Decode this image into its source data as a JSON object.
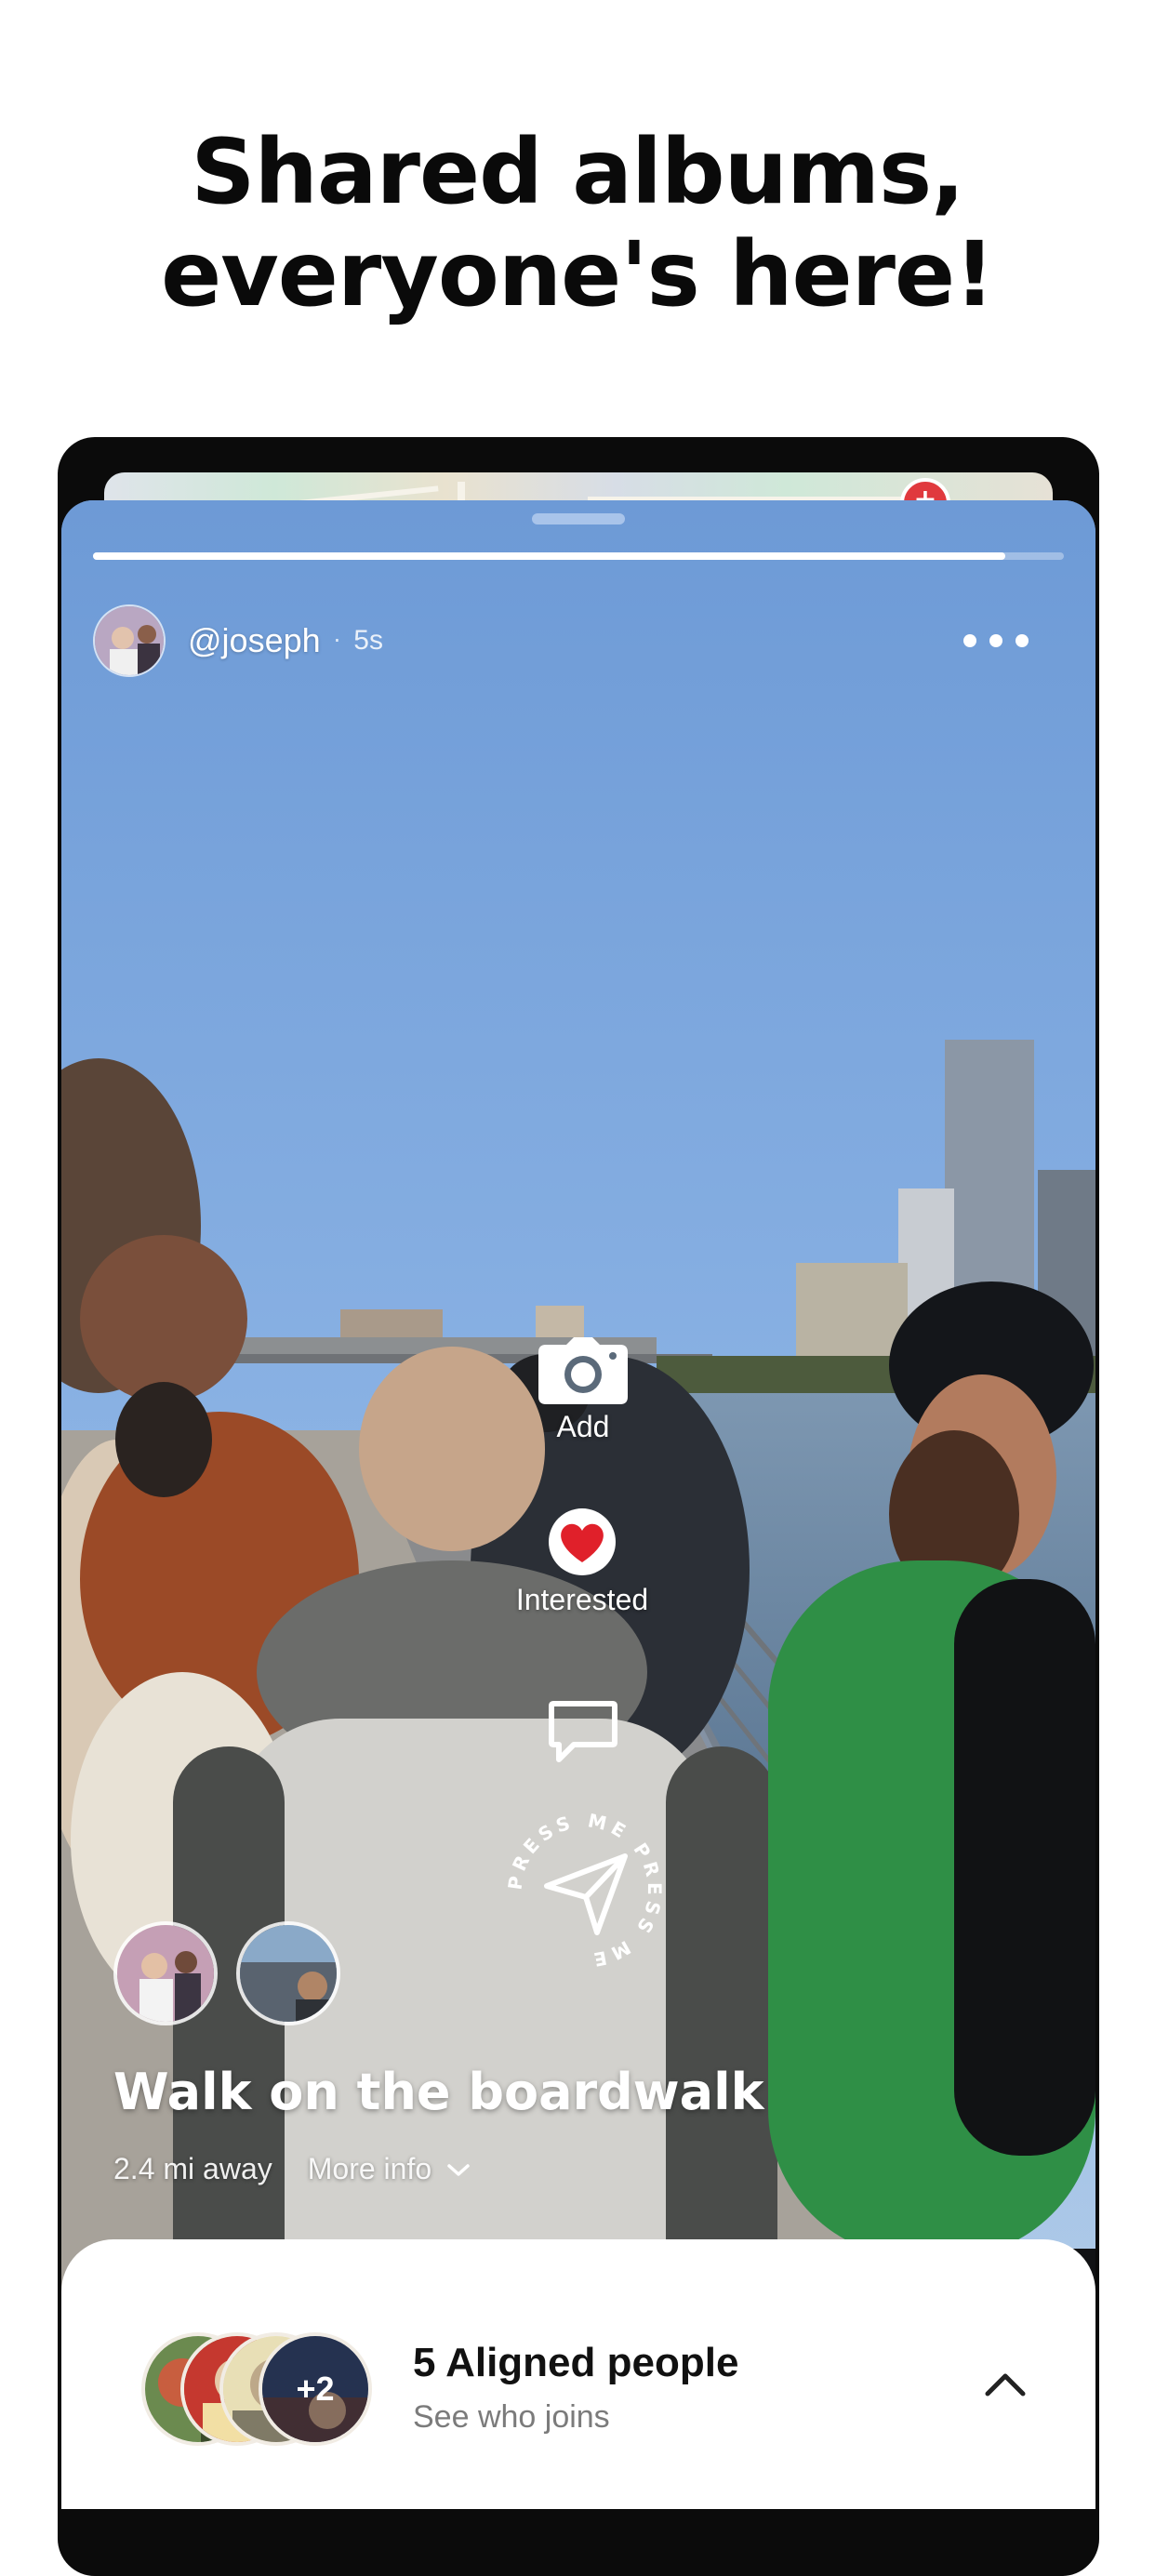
{
  "headline": {
    "line1": "Shared albums,",
    "line2": "everyone's here!"
  },
  "story": {
    "progress": 0.94,
    "username": "@joseph",
    "time_ago": "5s",
    "title": "Walk on the boardwalk",
    "distance": "2.4 mi away",
    "more_info_label": "More info"
  },
  "actions": {
    "add_label": "Add",
    "interested_label": "Interested",
    "press_me_text": "PRESS ME PRESS ME"
  },
  "sheet": {
    "title": "5 Aligned people",
    "subtitle": "See who joins",
    "extra_count": "+2"
  },
  "colors": {
    "sky": "#6f9bd6",
    "heart": "#e0202a",
    "text_dark": "#111111"
  }
}
